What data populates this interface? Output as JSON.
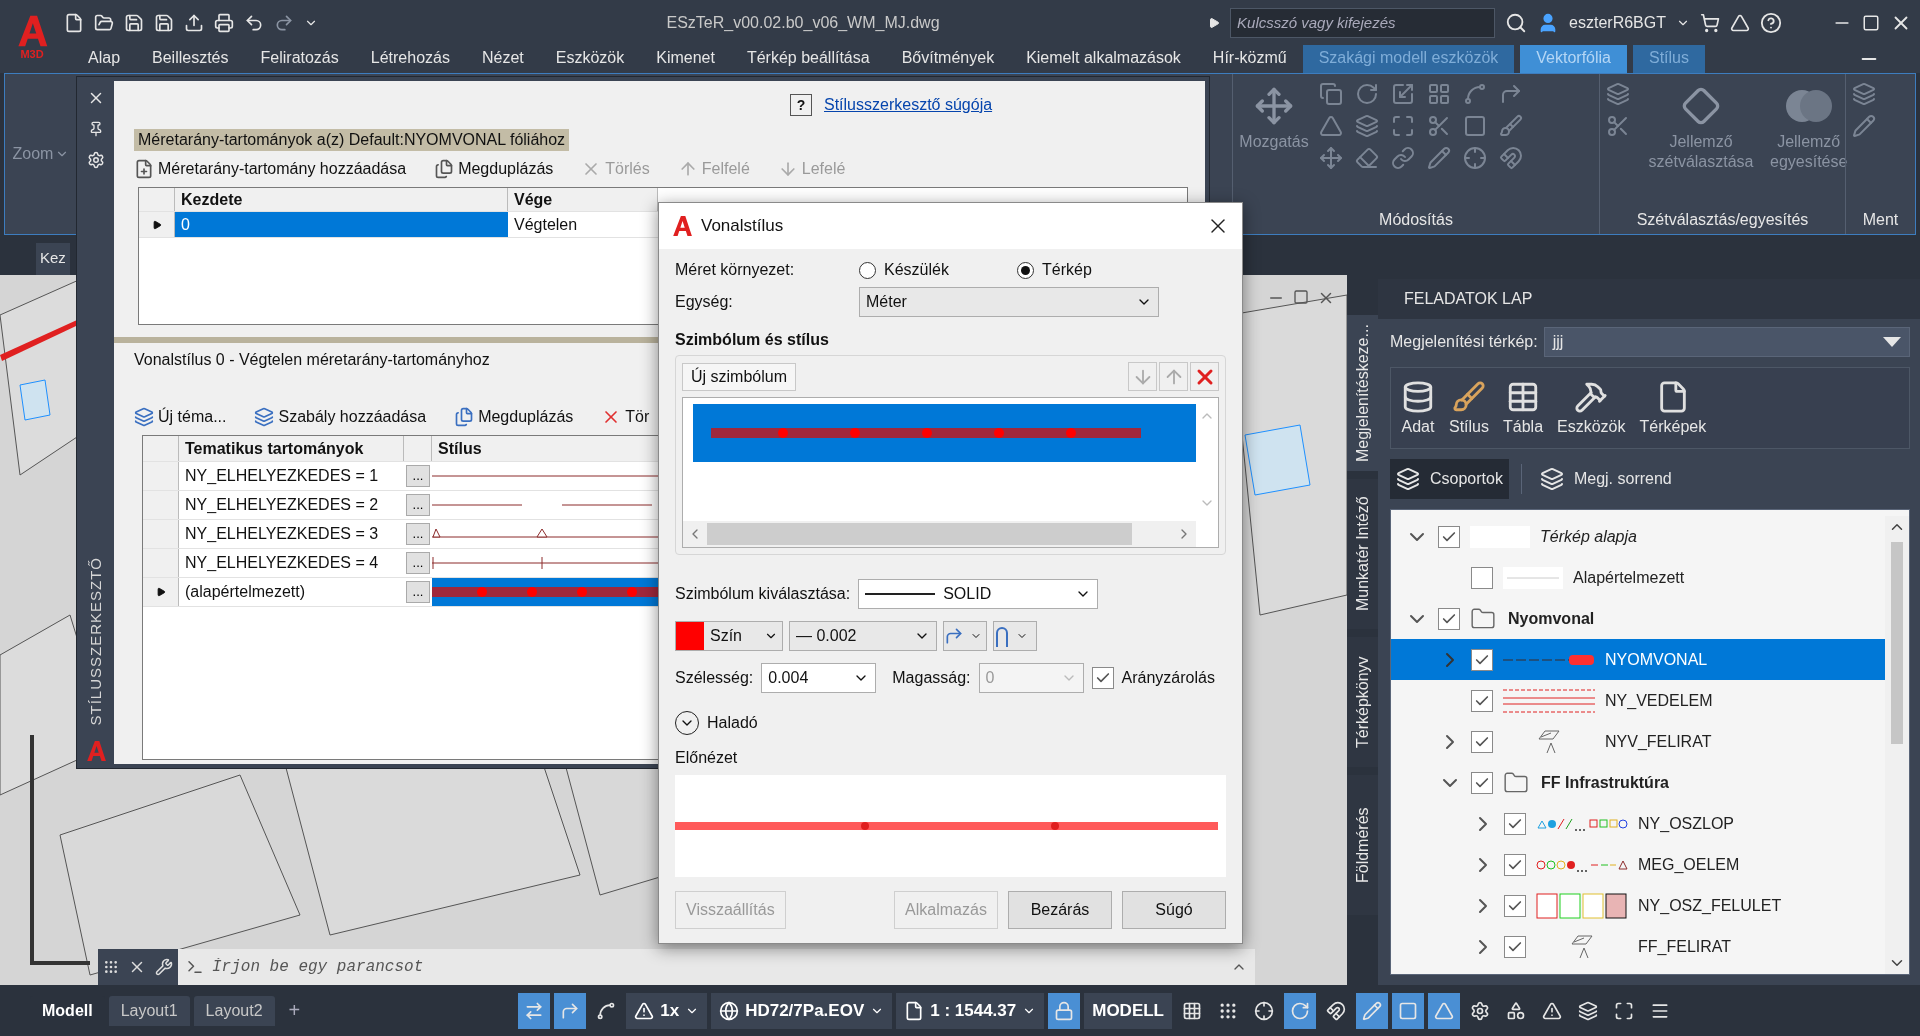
{
  "titlebar": {
    "app_badge": "M3D",
    "title": "ESzTeR_v00.02.b0_v06_WM_MJ.dwg",
    "search": {
      "placeholder": "Kulcsszó vagy kifejezés"
    },
    "user": "eszterR6BGT"
  },
  "menu_tabs": [
    {
      "label": "Alap",
      "kind": "normal",
      "selected": false
    },
    {
      "label": "Beillesztés",
      "kind": "normal",
      "selected": false
    },
    {
      "label": "Feliratozás",
      "kind": "normal",
      "selected": false
    },
    {
      "label": "Létrehozás",
      "kind": "normal",
      "selected": false
    },
    {
      "label": "Nézet",
      "kind": "normal",
      "selected": false
    },
    {
      "label": "Eszközök",
      "kind": "normal",
      "selected": false
    },
    {
      "label": "Kimenet",
      "kind": "normal",
      "selected": false
    },
    {
      "label": "Térkép beállítása",
      "kind": "normal",
      "selected": false
    },
    {
      "label": "Bővítmények",
      "kind": "normal",
      "selected": false
    },
    {
      "label": "Kiemelt alkalmazások",
      "kind": "normal",
      "selected": false
    },
    {
      "label": "Hír-közmű",
      "kind": "normal",
      "selected": false
    },
    {
      "label": "Szakági modell eszközök",
      "kind": "contextual",
      "selected": false
    },
    {
      "label": "Vektorfólia",
      "kind": "contextual",
      "selected": true
    },
    {
      "label": "Stílus",
      "kind": "contextual",
      "selected": false
    }
  ],
  "ribbon": {
    "zoom_label": "Zoom",
    "panels": [
      {
        "title": "Módosítás",
        "buttons": [
          {
            "label": "Mozgatás",
            "disabled": true
          }
        ]
      },
      {
        "title": "Szétválasztás/egyesítés",
        "buttons": [
          {
            "label": "Jellemző szétválasztása",
            "disabled": true
          },
          {
            "label": "Jellemző egyesítése",
            "disabled": true
          }
        ]
      },
      {
        "title": "Ment"
      }
    ]
  },
  "doc_tab": "Kez",
  "style_editor": {
    "side_title": "STÍLUSSZERKESZTŐ",
    "help_mark": "?",
    "help_link": "Stílusszerkesztő súgója",
    "scale_header": "Méretarány-tartományok a(z) Default:NYOMVONAL fóliához",
    "scale_toolbar": [
      {
        "label": "Méretarány-tartomány hozzáadása",
        "disabled": false
      },
      {
        "label": "Megduplázás",
        "disabled": false
      },
      {
        "label": "Törlés",
        "disabled": true
      },
      {
        "label": "Felfelé",
        "disabled": true
      },
      {
        "label": "Lefelé",
        "disabled": true
      }
    ],
    "scale_columns": [
      "Kezdete",
      "Vége"
    ],
    "scale_rows": [
      {
        "start": "0",
        "end": "Végtelen",
        "selected": true
      }
    ],
    "theme_header": "Vonalstílus 0 - Végtelen méretarány-tartományhoz",
    "theme_toolbar": [
      "Új téma...",
      "Szabály hozzáadása",
      "Megduplázás",
      "Tör"
    ],
    "theme_columns": [
      "Tematikus tartományok",
      "Stílus"
    ],
    "theme_rows": [
      {
        "label": "NY_ELHELYEZKEDES = 1",
        "button": "...",
        "kind": "solid",
        "selected": false
      },
      {
        "label": "NY_ELHELYEZKEDES = 2",
        "button": "...",
        "kind": "dashed",
        "selected": false
      },
      {
        "label": "NY_ELHELYEZKEDES = 3",
        "button": "...",
        "kind": "triangles",
        "selected": false
      },
      {
        "label": "NY_ELHELYEZKEDES = 4",
        "button": "...",
        "kind": "ticks",
        "selected": false
      },
      {
        "label": "(alapértelmezett)",
        "button": "...",
        "kind": "dots",
        "selected": true
      }
    ]
  },
  "dialog": {
    "title": "Vonalstílus",
    "size_context": {
      "label": "Méret környezet:",
      "options": [
        {
          "label": "Készülék",
          "selected": false
        },
        {
          "label": "Térkép",
          "selected": true
        }
      ]
    },
    "unit": {
      "label": "Egység:",
      "value": "Méter"
    },
    "symbol_section": "Szimbólum és stílus",
    "new_symbol": "Új szimbólum",
    "symbols": [
      {
        "selected": true
      }
    ],
    "symbol_select": {
      "label": "Szimbólum kiválasztása:",
      "value": "SOLID"
    },
    "color_label": "Szín",
    "weight": "— 0.002",
    "width": {
      "label": "Szélesség:",
      "value": "0.004"
    },
    "height": {
      "label": "Magasság:",
      "value": "0",
      "disabled": true
    },
    "lock": {
      "label": "Arányzárolás",
      "checked": true
    },
    "advanced": {
      "label": "Haladó",
      "expanded": false
    },
    "preview_label": "Előnézet",
    "buttons": [
      {
        "label": "Visszaállítás",
        "disabled": true
      },
      {
        "label": "Alkalmazás",
        "disabled": true
      },
      {
        "label": "Bezárás",
        "disabled": false
      },
      {
        "label": "Súgó",
        "disabled": false
      }
    ]
  },
  "task_pane": {
    "side_tabs": [
      {
        "label": "Megjelenítéskeze...",
        "selected": true
      },
      {
        "label": "Munkatér Intéző",
        "selected": false
      },
      {
        "label": "Térképkönyv",
        "selected": false
      },
      {
        "label": "Földmérés",
        "selected": false
      }
    ],
    "title": "FELADATOK LAP",
    "display_map": {
      "label": "Megjelenítési térkép:",
      "value": "jjj"
    },
    "tools": [
      "Adat",
      "Stílus",
      "Tábla",
      "Eszközök",
      "Térképek"
    ],
    "view_tabs": [
      {
        "label": "Csoportok",
        "selected": true
      },
      {
        "label": "Megj. sorrend",
        "selected": false
      }
    ],
    "tree": [
      {
        "label": "Térkép alapja",
        "kind": "blank",
        "checked": true,
        "expanded": true,
        "selected": false,
        "children": [
          {
            "label": "Alapértelmezett",
            "kind": "thin-line",
            "checked": false,
            "selected": false
          }
        ]
      },
      {
        "label": "Nyomvonal",
        "kind": "folder",
        "checked": true,
        "expanded": true,
        "selected": false,
        "children": [
          {
            "label": "NYOMVONAL",
            "kind": "route",
            "checked": true,
            "expanded": false,
            "selected": true
          },
          {
            "label": "NY_VEDELEM",
            "kind": "double-line",
            "checked": true,
            "selected": false
          },
          {
            "label": "NYV_FELIRAT",
            "kind": "label",
            "checked": true,
            "expanded": false,
            "selected": false
          },
          {
            "label": "FF Infrastruktúra",
            "kind": "folder",
            "checked": true,
            "expanded": true,
            "selected": false,
            "children": [
              {
                "label": "NY_OSZLOP",
                "kind": "points",
                "checked": true,
                "expanded": false,
                "selected": false
              },
              {
                "label": "MEG_OELEM",
                "kind": "symbols",
                "checked": true,
                "expanded": false,
                "selected": false
              },
              {
                "label": "NY_OSZ_FELULET",
                "kind": "areas",
                "checked": true,
                "expanded": false,
                "selected": false
              },
              {
                "label": "FF_FELIRAT",
                "kind": "label",
                "checked": true,
                "expanded": false,
                "selected": false
              }
            ]
          }
        ]
      }
    ]
  },
  "command_line": {
    "placeholder": "Írjon be egy parancsot"
  },
  "layout_tabs": [
    {
      "label": "Modell",
      "selected": true
    },
    {
      "label": "Layout1",
      "selected": false
    },
    {
      "label": "Layout2",
      "selected": false
    }
  ],
  "add_tab": "+",
  "status": {
    "scale_factor": "1x",
    "coord_system": "HD72/7Pa.EOV",
    "scale": "1 : 1544.37",
    "space": "MODELL"
  },
  "status_toggles": [
    {
      "on": true
    },
    {
      "on": true
    },
    {
      "on": false
    },
    {
      "on": true
    },
    {
      "on": false
    },
    {
      "on": false
    },
    {
      "on": false
    },
    {
      "on": true
    },
    {
      "on": false
    },
    {
      "on": true
    },
    {
      "on": true
    },
    {
      "on": true
    },
    {
      "on": false
    },
    {
      "on": false
    },
    {
      "on": false
    },
    {
      "on": false
    },
    {
      "on": false
    },
    {
      "on": false
    }
  ]
}
